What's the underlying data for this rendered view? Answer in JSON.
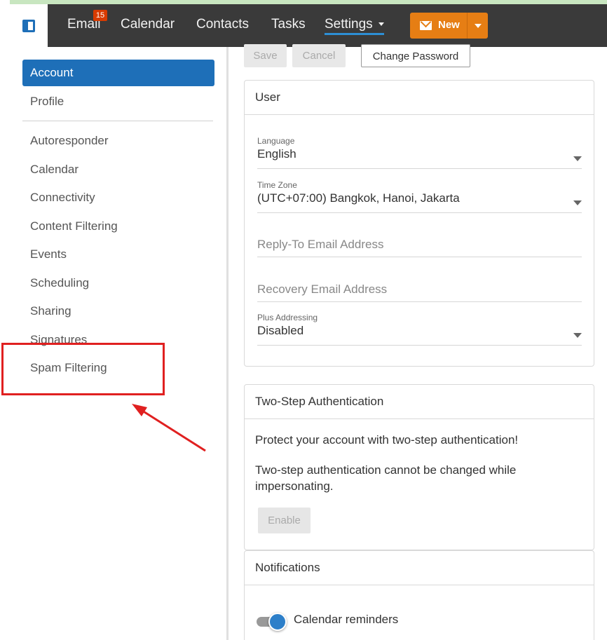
{
  "topbar": {
    "nav": {
      "email": "Email",
      "email_badge": "15",
      "calendar": "Calendar",
      "contacts": "Contacts",
      "tasks": "Tasks",
      "settings": "Settings"
    },
    "new_button": "New"
  },
  "sidebar": {
    "items": [
      {
        "label": "Account",
        "active": true
      },
      {
        "label": "Profile"
      },
      {
        "label": "Autoresponder"
      },
      {
        "label": "Calendar"
      },
      {
        "label": "Connectivity"
      },
      {
        "label": "Content Filtering"
      },
      {
        "label": "Events"
      },
      {
        "label": "Scheduling"
      },
      {
        "label": "Sharing"
      },
      {
        "label": "Signatures"
      },
      {
        "label": "Spam Filtering"
      }
    ]
  },
  "toolbar": {
    "save": "Save",
    "cancel": "Cancel",
    "change_password": "Change Password"
  },
  "user_card": {
    "title": "User",
    "language_label": "Language",
    "language_value": "English",
    "timezone_label": "Time Zone",
    "timezone_value": "(UTC+07:00) Bangkok, Hanoi, Jakarta",
    "reply_to_placeholder": "Reply-To Email Address",
    "recovery_placeholder": "Recovery Email Address",
    "plus_label": "Plus Addressing",
    "plus_value": "Disabled"
  },
  "two_step_card": {
    "title": "Two-Step Authentication",
    "text1": "Protect your account with two-step authentication!",
    "text2a": "Two-step authentication cannot be changed while",
    "text2b": "impersonating.",
    "enable": "Enable"
  },
  "notifications_card": {
    "title": "Notifications",
    "calendar_reminders": "Calendar reminders",
    "calendar_reminders_on": true
  },
  "colors": {
    "accent": "#1e6fb8",
    "new_button": "#e67e14",
    "topbar": "#3a3a3a",
    "annotation": "#e02020"
  }
}
